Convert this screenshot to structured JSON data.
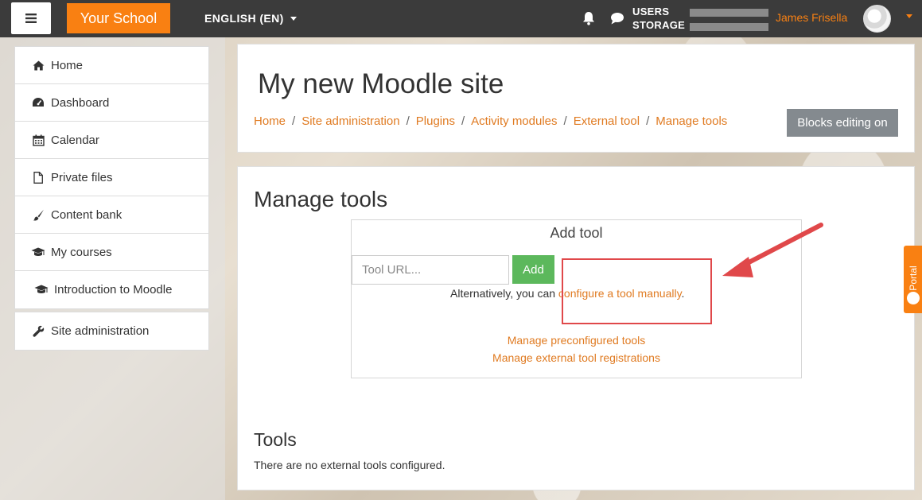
{
  "navbar": {
    "brand": "Your School",
    "language": "ENGLISH (EN)",
    "usage_users": "USERS",
    "usage_storage": "STORAGE",
    "user_name": "James Frisella"
  },
  "sidebar": {
    "items": [
      {
        "label": "Home",
        "icon": "home-icon"
      },
      {
        "label": "Dashboard",
        "icon": "dashboard-icon"
      },
      {
        "label": "Calendar",
        "icon": "calendar-icon"
      },
      {
        "label": "Private files",
        "icon": "file-icon"
      },
      {
        "label": "Content bank",
        "icon": "paintbrush-icon"
      },
      {
        "label": "My courses",
        "icon": "graduation-cap-icon"
      },
      {
        "label": "Introduction to Moodle",
        "icon": "graduation-cap-icon"
      }
    ],
    "admin": {
      "label": "Site administration",
      "icon": "wrench-icon"
    }
  },
  "header": {
    "site_title": "My new Moodle site",
    "breadcrumb": [
      "Home",
      "Site administration",
      "Plugins",
      "Activity modules",
      "External tool",
      "Manage tools"
    ],
    "breadcrumb_separator": "/",
    "blocks_editing": "Blocks editing on"
  },
  "main": {
    "heading": "Manage tools",
    "add_tool": {
      "title": "Add tool",
      "url_placeholder": "Tool URL...",
      "add_label": "Add",
      "alt_prefix": "Alternatively, you can",
      "alt_link": "configure a tool manually",
      "alt_suffix": ".",
      "preconfigured_link": "Manage preconfigured tools",
      "registrations_link": "Manage external tool registrations"
    },
    "tools_heading": "Tools",
    "tools_empty": "There are no external tools configured."
  },
  "portal_tab": "Portal",
  "colors": {
    "brand": "#f98012",
    "link": "#e07b22",
    "navbar": "#3b3b3b",
    "add_button": "#5cb85c",
    "annotation": "#e0484a"
  }
}
